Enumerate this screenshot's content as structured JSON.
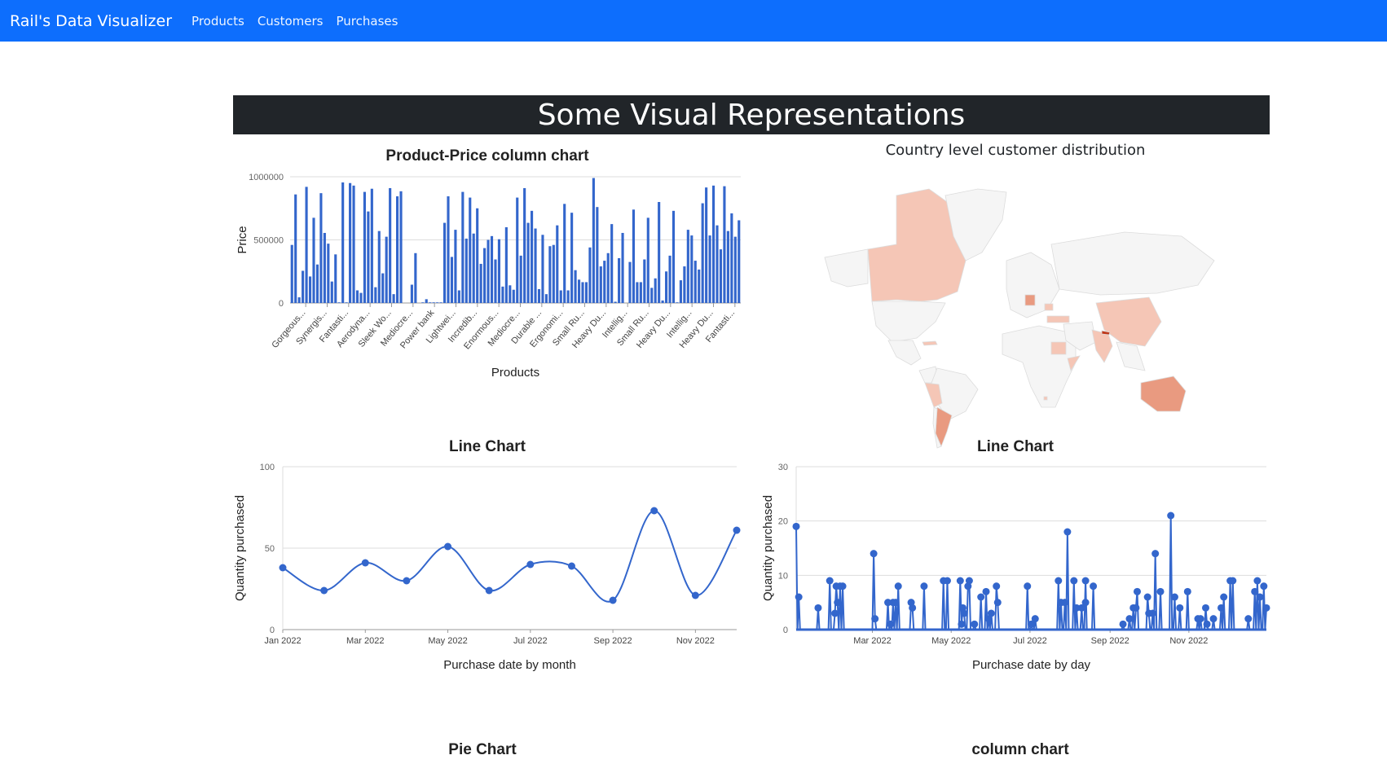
{
  "navbar": {
    "brand": "Rail's Data Visualizer",
    "links": [
      "Products",
      "Customers",
      "Purchases"
    ]
  },
  "banner": {
    "title": "Some Visual Representations"
  },
  "colors": {
    "navbar": "#0d6efd",
    "banner": "#212529",
    "series": "#3366cc",
    "map_empty": "#f5f5f5",
    "map_low": "#f5c6b6",
    "map_mid": "#e99a80",
    "map_high": "#c0391b"
  },
  "map": {
    "title": "Country level customer distribution",
    "highlighted_countries": [
      {
        "name": "Canada",
        "level": "low"
      },
      {
        "name": "Germany",
        "level": "mid"
      },
      {
        "name": "Romania",
        "level": "low"
      },
      {
        "name": "Turkey",
        "level": "low"
      },
      {
        "name": "Sudan",
        "level": "low"
      },
      {
        "name": "Somalia",
        "level": "low"
      },
      {
        "name": "China",
        "level": "low"
      },
      {
        "name": "India",
        "level": "low"
      },
      {
        "name": "Nepal",
        "level": "high"
      },
      {
        "name": "Peru",
        "level": "low"
      },
      {
        "name": "Argentina",
        "level": "mid"
      },
      {
        "name": "Australia",
        "level": "mid"
      },
      {
        "name": "Cuba",
        "level": "low"
      },
      {
        "name": "Lesotho",
        "level": "low"
      }
    ]
  },
  "bottom_titles": {
    "pie": "Pie Chart",
    "column": "column chart"
  },
  "chart_data": [
    {
      "id": "product-price",
      "type": "bar",
      "title": "Product-Price column chart",
      "xlabel": "Products",
      "ylabel": "Price",
      "ylim": [
        0,
        1000000
      ],
      "yticks": [
        0,
        500000,
        1000000
      ],
      "ytick_labels": [
        "0",
        "500000",
        "1000000"
      ],
      "xtick_labels": [
        "Gorgeous...",
        "Synergis...",
        "Fantasti...",
        "Aerodyna...",
        "Sleek Wo...",
        "Mediocre...",
        "Power bank",
        "Lightwei...",
        "Incredib...",
        "Enormous...",
        "Mediocre...",
        "Durable ...",
        "Ergonomi...",
        "Small Ru...",
        "Heavy Du...",
        "Intellig...",
        "Small Ru...",
        "Heavy Du...",
        "Intellig...",
        "Heavy Du...",
        "Fantasti..."
      ],
      "values": [
        460000,
        860000,
        45000,
        255000,
        920000,
        210000,
        675000,
        305000,
        870000,
        555000,
        470000,
        170000,
        385000,
        5000,
        955000,
        5000,
        950000,
        930000,
        100000,
        80000,
        880000,
        725000,
        905000,
        125000,
        570000,
        235000,
        525000,
        910000,
        70000,
        845000,
        885000,
        0,
        0,
        145000,
        395000,
        0,
        5000,
        30000,
        5000,
        5000,
        5000,
        5000,
        635000,
        845000,
        365000,
        580000,
        100000,
        880000,
        510000,
        835000,
        550000,
        750000,
        310000,
        435000,
        500000,
        530000,
        345000,
        505000,
        130000,
        600000,
        140000,
        105000,
        835000,
        375000,
        910000,
        635000,
        730000,
        590000,
        110000,
        540000,
        70000,
        450000,
        460000,
        615000,
        100000,
        785000,
        100000,
        715000,
        260000,
        185000,
        165000,
        165000,
        440000,
        990000,
        760000,
        290000,
        335000,
        395000,
        625000,
        10000,
        355000,
        555000,
        0,
        325000,
        740000,
        165000,
        165000,
        345000,
        675000,
        120000,
        195000,
        800000,
        20000,
        250000,
        375000,
        730000,
        5000,
        180000,
        290000,
        580000,
        535000,
        335000,
        265000,
        790000,
        915000,
        535000,
        930000,
        615000,
        425000,
        925000,
        570000,
        710000,
        525000,
        655000
      ]
    },
    {
      "id": "line-monthly",
      "type": "line",
      "title": "Line Chart",
      "xlabel": "Purchase date by month",
      "ylabel": "Quantity purchased",
      "ylim": [
        0,
        100
      ],
      "yticks": [
        0,
        50,
        100
      ],
      "x": [
        "Jan 2022",
        "Feb 2022",
        "Mar 2022",
        "Apr 2022",
        "May 2022",
        "Jun 2022",
        "Jul 2022",
        "Aug 2022",
        "Sep 2022",
        "Oct 2022",
        "Nov 2022",
        "Dec 2022"
      ],
      "xtick_labels": [
        "Jan 2022",
        "Mar 2022",
        "May 2022",
        "Jul 2022",
        "Sep 2022",
        "Nov 2022"
      ],
      "values": [
        38,
        24,
        41,
        30,
        51,
        24,
        40,
        39,
        18,
        73,
        21,
        61
      ],
      "smooth": true
    },
    {
      "id": "line-daily",
      "type": "line",
      "title": "Line Chart",
      "xlabel": "Purchase date by day",
      "ylabel": "Quantity purchased",
      "ylim": [
        0,
        30
      ],
      "yticks": [
        0,
        10,
        20,
        30
      ],
      "xtick_labels": [
        "Mar 2022",
        "May 2022",
        "Jul 2022",
        "Sep 2022",
        "Nov 2022"
      ],
      "xtick_days": [
        59,
        120,
        181,
        243,
        304
      ],
      "x_range_days": [
        0,
        364
      ],
      "points": [
        [
          0,
          19
        ],
        [
          2,
          6
        ],
        [
          17,
          4
        ],
        [
          26,
          9
        ],
        [
          30,
          3
        ],
        [
          31,
          8
        ],
        [
          32,
          5
        ],
        [
          34,
          8
        ],
        [
          36,
          8
        ],
        [
          60,
          14
        ],
        [
          61,
          2
        ],
        [
          71,
          5
        ],
        [
          73,
          1
        ],
        [
          75,
          5
        ],
        [
          77,
          5
        ],
        [
          79,
          8
        ],
        [
          89,
          5
        ],
        [
          90,
          4
        ],
        [
          99,
          8
        ],
        [
          114,
          9
        ],
        [
          117,
          9
        ],
        [
          127,
          9
        ],
        [
          128,
          1
        ],
        [
          129,
          4
        ],
        [
          130,
          3
        ],
        [
          133,
          8
        ],
        [
          134,
          9
        ],
        [
          138,
          1
        ],
        [
          143,
          6
        ],
        [
          147,
          7
        ],
        [
          149,
          2
        ],
        [
          151,
          3
        ],
        [
          155,
          8
        ],
        [
          156,
          5
        ],
        [
          179,
          8
        ],
        [
          182,
          1
        ],
        [
          185,
          2
        ],
        [
          203,
          9
        ],
        [
          205,
          5
        ],
        [
          208,
          5
        ],
        [
          210,
          18
        ],
        [
          215,
          9
        ],
        [
          217,
          4
        ],
        [
          221,
          4
        ],
        [
          224,
          5
        ],
        [
          224,
          9
        ],
        [
          230,
          8
        ],
        [
          253,
          1
        ],
        [
          258,
          2
        ],
        [
          261,
          4
        ],
        [
          263,
          4
        ],
        [
          264,
          7
        ],
        [
          272,
          6
        ],
        [
          273,
          3
        ],
        [
          276,
          3
        ],
        [
          278,
          14
        ],
        [
          282,
          7
        ],
        [
          290,
          21
        ],
        [
          293,
          6
        ],
        [
          297,
          4
        ],
        [
          303,
          7
        ],
        [
          311,
          2
        ],
        [
          313,
          2
        ],
        [
          317,
          4
        ],
        [
          318,
          1
        ],
        [
          323,
          2
        ],
        [
          329,
          4
        ],
        [
          331,
          6
        ],
        [
          336,
          9
        ],
        [
          338,
          9
        ],
        [
          350,
          2
        ],
        [
          355,
          7
        ],
        [
          357,
          9
        ],
        [
          359,
          6
        ],
        [
          362,
          8
        ],
        [
          364,
          4
        ]
      ]
    }
  ]
}
